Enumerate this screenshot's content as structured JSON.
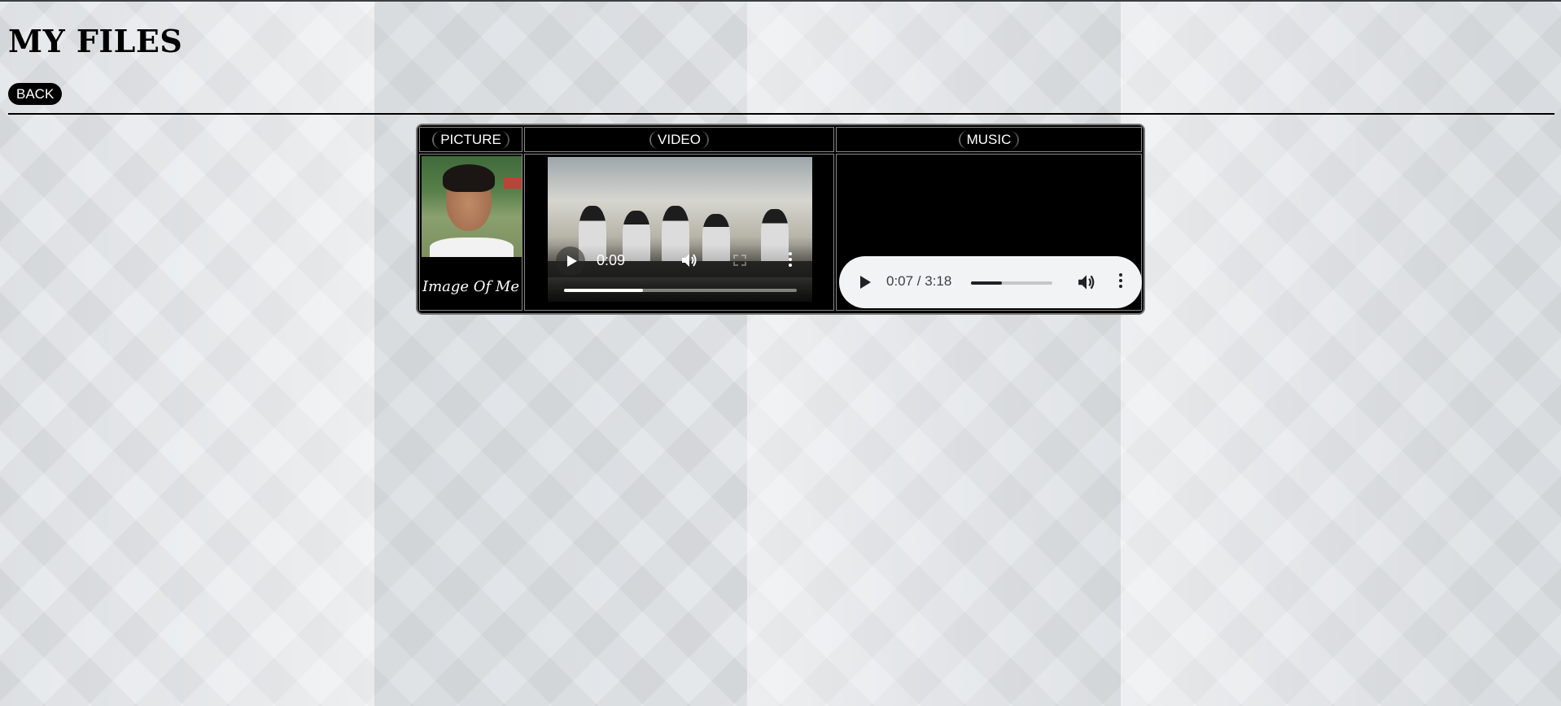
{
  "page": {
    "title": "MY FILES",
    "back_label": "BACK"
  },
  "table": {
    "headers": {
      "picture": "PICTURE",
      "video": "VIDEO",
      "music": "MUSIC"
    },
    "picture": {
      "caption": "Image Of Me"
    },
    "video": {
      "current_time": "0:09",
      "progress": 0.34
    },
    "music": {
      "time": "0:07 / 3:18",
      "progress": 0.38
    }
  },
  "icons": {
    "play": "play-icon",
    "volume": "volume-icon",
    "fullscreen": "fullscreen-icon",
    "more": "more-options-icon"
  }
}
